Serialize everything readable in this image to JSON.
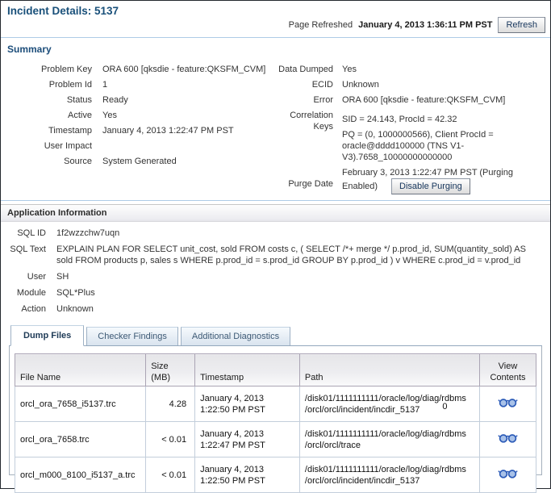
{
  "colors": {
    "title": "#19507a",
    "section_heading": "#1c4d7a",
    "rule_blue": "#aecbe6",
    "icon_blue": "#2d5cb8"
  },
  "page": {
    "title": "Incident Details: 5137",
    "refreshed_label": "Page Refreshed",
    "refreshed_value": "January 4, 2013 1:36:11 PM PST",
    "refresh_button": "Refresh"
  },
  "summary": {
    "heading": "Summary",
    "left": [
      {
        "label": "Problem Key",
        "value": "ORA 600 [qksdie - feature:QKSFM_CVM]"
      },
      {
        "label": "Problem Id",
        "value": "1"
      },
      {
        "label": "Status",
        "value": "Ready"
      },
      {
        "label": "Active",
        "value": "Yes"
      },
      {
        "label": "Timestamp",
        "value": "January 4, 2013 1:22:47 PM PST"
      },
      {
        "label": "User Impact",
        "value": ""
      },
      {
        "label": "Source",
        "value": "System Generated"
      }
    ],
    "right": {
      "data_dumped": {
        "label": "Data Dumped",
        "value": "Yes"
      },
      "ecid": {
        "label": "ECID",
        "value": "Unknown"
      },
      "error": {
        "label": "Error",
        "value": "ORA 600 [qksdie - feature:QKSFM_CVM]"
      },
      "correlation": {
        "label": "Correlation Keys",
        "value1": "SID = 24.143, ProcId = 42.32",
        "value2": "PQ = (0, 1000000566), Client ProcId = oracle@dddd100000 (TNS V1-V3).7658_10000000000000"
      },
      "purge": {
        "label": "Purge Date",
        "value": "February 3, 2013 1:22:47 PM PST (Purging Enabled)",
        "button": "Disable Purging"
      }
    }
  },
  "app_info": {
    "heading": "Application Information",
    "fields": [
      {
        "label": "SQL ID",
        "value": "1f2wzzchw7uqn"
      },
      {
        "label": "SQL Text",
        "value": "EXPLAIN PLAN FOR SELECT unit_cost, sold FROM costs c, ( SELECT /*+ merge */ p.prod_id, SUM(quantity_sold) AS sold FROM products p, sales s WHERE p.prod_id = s.prod_id GROUP BY p.prod_id ) v WHERE c.prod_id = v.prod_id"
      },
      {
        "label": "User",
        "value": "SH"
      },
      {
        "label": "Module",
        "value": "SQL*Plus"
      },
      {
        "label": "Action",
        "value": "Unknown"
      }
    ]
  },
  "tabs": [
    {
      "label": "Dump Files",
      "active": true
    },
    {
      "label": "Checker Findings",
      "active": false
    },
    {
      "label": "Additional Diagnostics",
      "active": false
    }
  ],
  "dump_table": {
    "columns": [
      "File Name",
      "Size (MB)",
      "Timestamp",
      "Path",
      "View Contents"
    ],
    "rows": [
      {
        "file_name": "orcl_ora_7658_i5137.trc",
        "size_mb": "4.28",
        "timestamp": "January 4, 2013 1:22:50 PM PST",
        "path_line1": "/disk01/1111111111/oracle/log/diag/rdbms",
        "path_line2": "/orcl/orcl/incident/incdir_5137",
        "path_note": "0",
        "view_icon": "eyeglasses-icon"
      },
      {
        "file_name": "orcl_ora_7658.trc",
        "size_mb": "< 0.01",
        "timestamp": "January 4, 2013 1:22:47 PM PST",
        "path_line1": "/disk01/1111111111/oracle/log/diag/rdbms",
        "path_line2": "/orcl/orcl/trace",
        "path_note": "",
        "view_icon": "eyeglasses-icon"
      },
      {
        "file_name": "orcl_m000_8100_i5137_a.trc",
        "size_mb": "< 0.01",
        "timestamp": "January 4, 2013 1:22:50 PM PST",
        "path_line1": "/disk01/1111111111/oracle/log/diag/rdbms",
        "path_line2": "/orcl/orcl/incident/incdir_5137",
        "path_note": "",
        "view_icon": "eyeglasses-icon"
      }
    ]
  }
}
